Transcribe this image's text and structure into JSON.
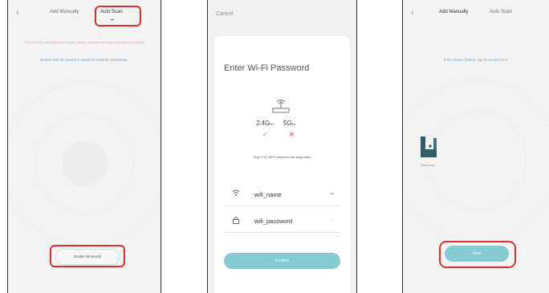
{
  "screen1": {
    "back_icon": "‹",
    "tabs": [
      "Add Manually",
      "Auto Scan"
    ],
    "warning": "Turn on Wi-Fi and Bluetooth on your phone, and allow the app to access the location",
    "hint": "Ensure that the device is ready for network connection.",
    "button": "Enable Bluetooth"
  },
  "screen2": {
    "cancel": "Cancel",
    "title": "Enter Wi-Fi Password",
    "router_icon": "router-icon",
    "band_24": "2.4G",
    "band_24_unit": "Hz",
    "band_5": "5G",
    "band_5_unit": "Hz",
    "band_24_mark": "✓",
    "band_5_mark": "✕",
    "note": "Only 2.4G Wi-Fi networks are supported.",
    "wifi_name": "wifi_name",
    "wifi_password": "wifi_password",
    "name_tail": "⇆",
    "password_tail": "◌",
    "confirm": "Confirm"
  },
  "screen3": {
    "back_icon": "‹",
    "tabs": [
      "Add Manually",
      "Auto Scan"
    ],
    "hint": "If the device flickers, tap to connect to it.",
    "device_label": "Smart Lock",
    "next": "Next"
  },
  "colors": {
    "accent": "#86cbd2",
    "highlight": "#e0302e",
    "ok": "#51b24f"
  }
}
